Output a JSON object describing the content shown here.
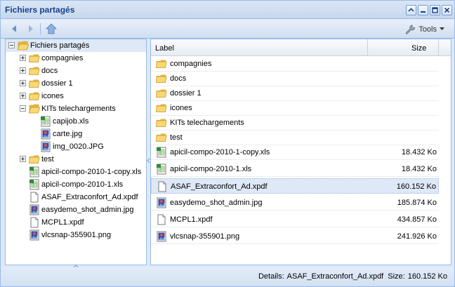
{
  "window": {
    "title": "Fichiers partagés"
  },
  "toolbar": {
    "tools_label": "Tools"
  },
  "tree": {
    "root_label": "Fichiers partagés",
    "folders": [
      {
        "label": "compagnies"
      },
      {
        "label": "docs"
      },
      {
        "label": "dossier 1"
      },
      {
        "label": "icones"
      },
      {
        "label": "KITs telechargements",
        "children": [
          "capijob.xls",
          "carte.jpg",
          "img_0020.JPG"
        ]
      },
      {
        "label": "test"
      }
    ],
    "files": [
      "apicil-compo-2010-1-copy.xls",
      "apicil-compo-2010-1.xls",
      "ASAF_Extraconfort_Ad.xpdf",
      "easydemo_shot_admin.jpg",
      "MCPL1.xpdf",
      "vlcsnap-355901.png"
    ]
  },
  "grid": {
    "columns": {
      "label": "Label",
      "size": "Size"
    },
    "rows": [
      {
        "label": "compagnies",
        "size": "",
        "type": "folder"
      },
      {
        "label": "docs",
        "size": "",
        "type": "folder"
      },
      {
        "label": "dossier 1",
        "size": "",
        "type": "folder"
      },
      {
        "label": "icones",
        "size": "",
        "type": "folder"
      },
      {
        "label": "KITs telechargements",
        "size": "",
        "type": "folder"
      },
      {
        "label": "test",
        "size": "",
        "type": "folder"
      },
      {
        "label": "apicil-compo-2010-1-copy.xls",
        "size": "18.432 Ko",
        "type": "xls"
      },
      {
        "label": "apicil-compo-2010-1.xls",
        "size": "18.432 Ko",
        "type": "xls"
      },
      {
        "label": "ASAF_Extraconfort_Ad.xpdf",
        "size": "160.152 Ko",
        "type": "doc"
      },
      {
        "label": "easydemo_shot_admin.jpg",
        "size": "185.874 Ko",
        "type": "img"
      },
      {
        "label": "MCPL1.xpdf",
        "size": "434.857 Ko",
        "type": "doc"
      },
      {
        "label": "vlcsnap-355901.png",
        "size": "241.926 Ko",
        "type": "img"
      }
    ]
  },
  "status": {
    "details_prefix": "Details:",
    "details_value": "ASAF_Extraconfort_Ad.xpdf",
    "size_prefix": "Size:",
    "size_value": "160.152 Ko"
  },
  "colors": {
    "accent": "#15428b",
    "border": "#99bbe8",
    "selection": "#dfe8f6"
  }
}
